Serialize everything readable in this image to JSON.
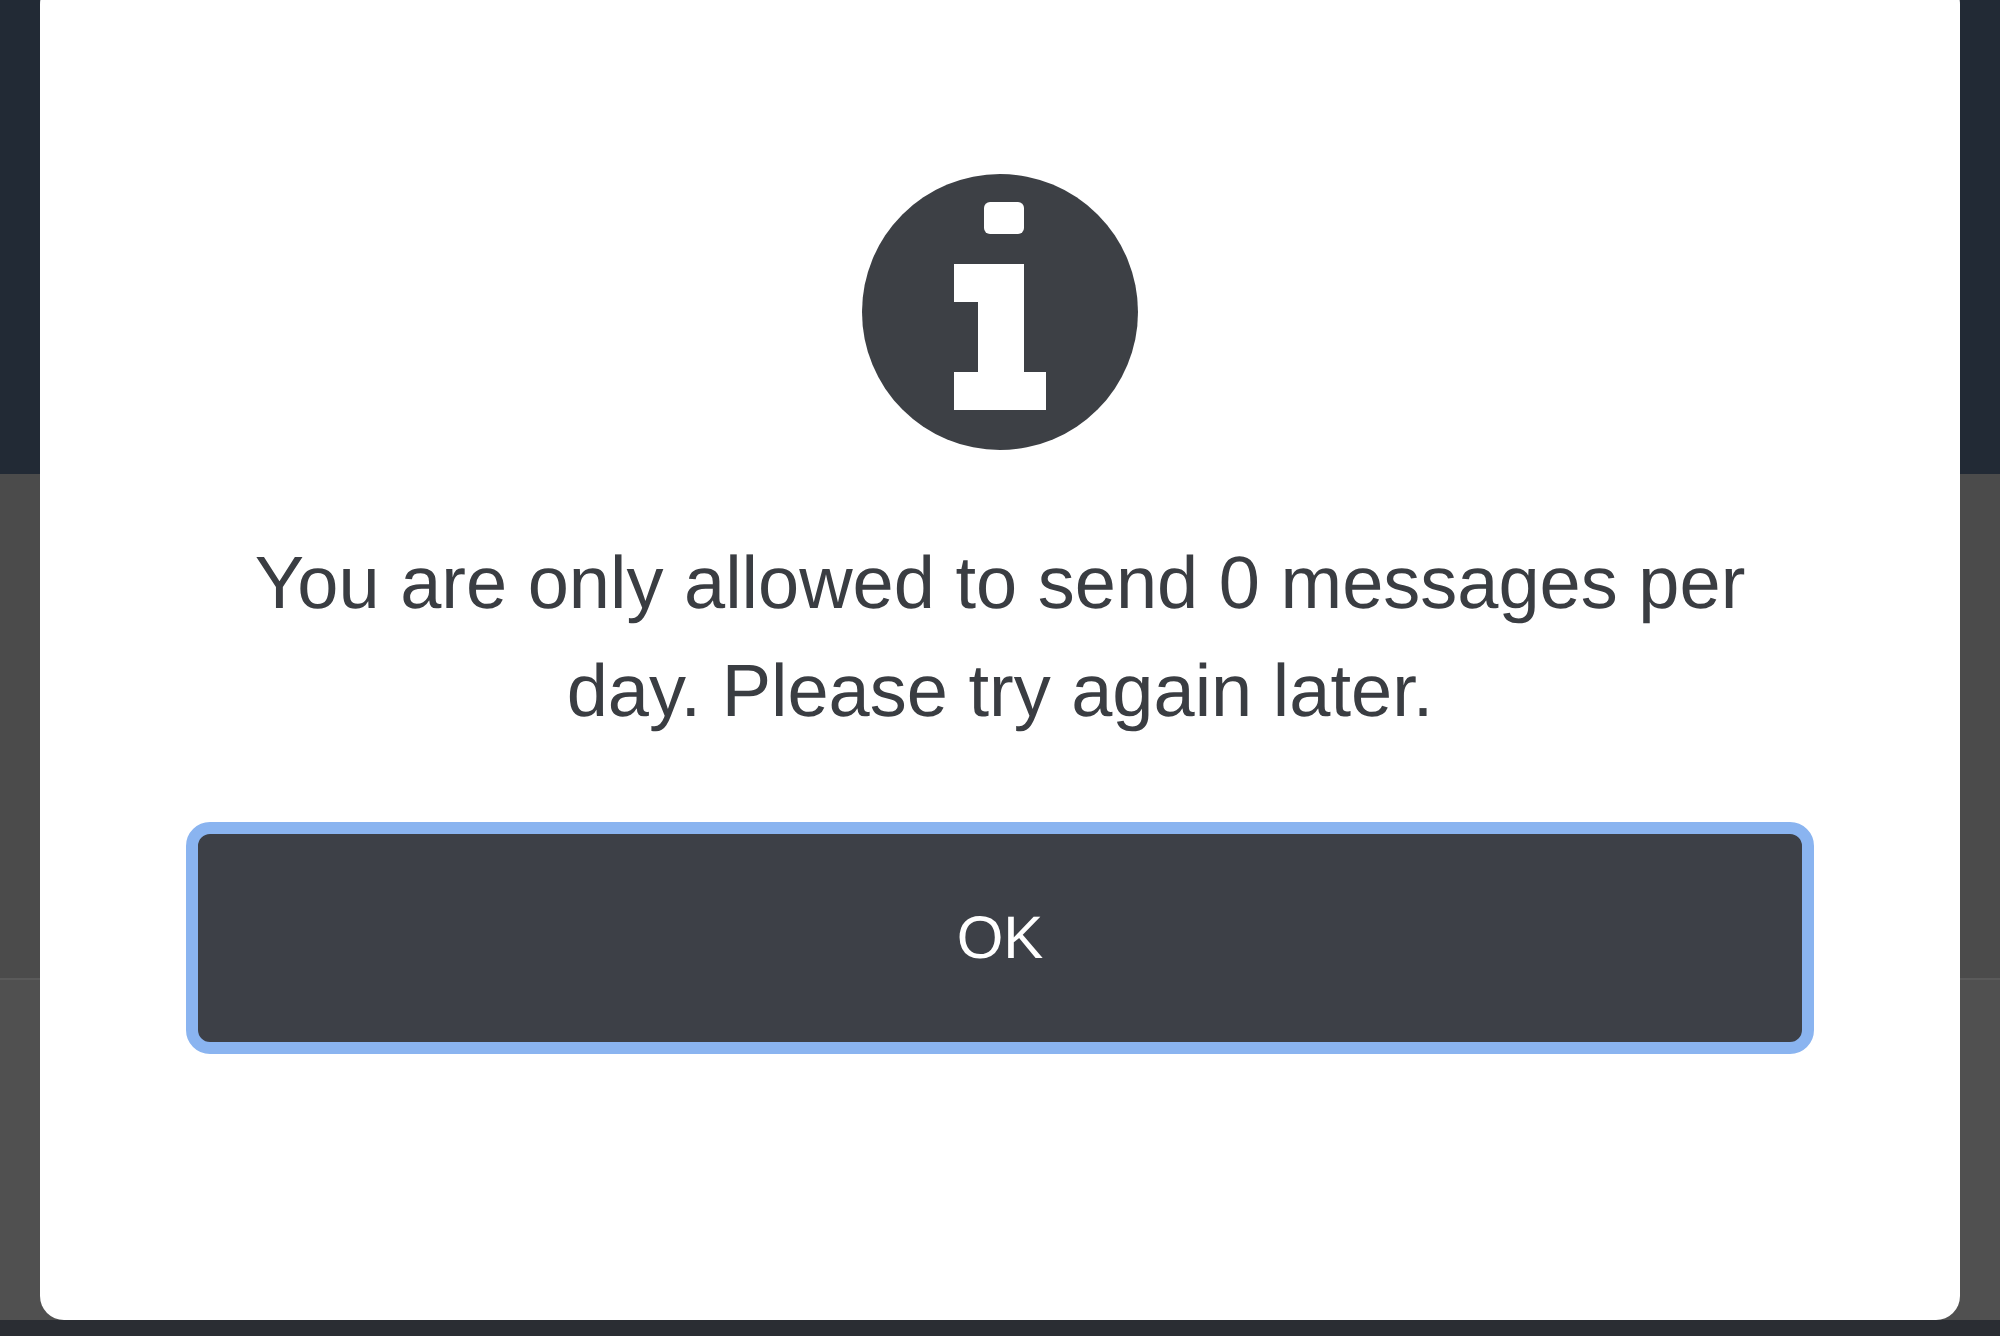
{
  "dialog": {
    "message": "You are only allowed to send 0 messages per day. Please try again later.",
    "buttons": [
      {
        "label": "OK",
        "focused": true
      }
    ]
  }
}
